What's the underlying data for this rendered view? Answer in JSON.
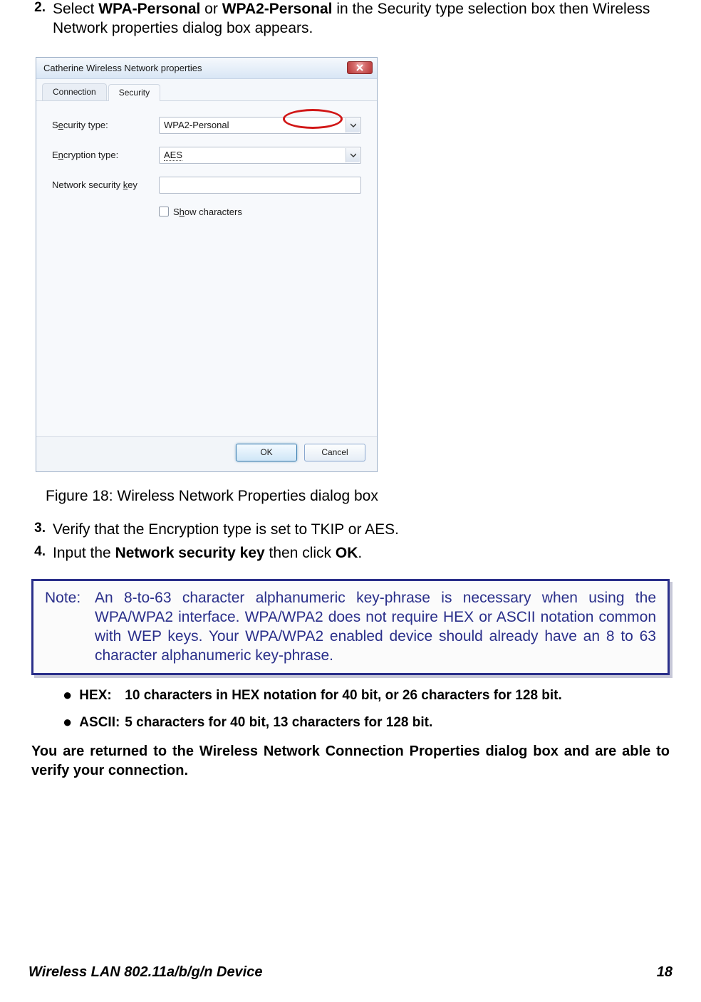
{
  "steps": {
    "s2": {
      "num": "2.",
      "pre": "Select ",
      "b1": "WPA-Personal",
      "mid": " or ",
      "b2": "WPA2-Personal",
      "post": " in the Security type selection box then Wireless Network properties dialog box appears."
    },
    "s3": {
      "num": "3.",
      "text": "Verify that the Encryption type is set to TKIP or AES."
    },
    "s4": {
      "num": "4.",
      "pre": "Input the ",
      "b1": "Network security key",
      "mid": " then click ",
      "b2": "OK",
      "post": "."
    }
  },
  "dialog": {
    "title": "Catherine Wireless Network properties",
    "tabs": {
      "connection": "Connection",
      "security": "Security"
    },
    "labels": {
      "security_type_pre": "S",
      "security_type_u": "e",
      "security_type_post": "curity type:",
      "encryption_pre": "E",
      "encryption_u": "n",
      "encryption_post": "cryption type:",
      "network_key_pre": "Network security ",
      "network_key_u": "k",
      "network_key_post": "ey",
      "show_pre": "S",
      "show_u": "h",
      "show_post": "ow characters"
    },
    "values": {
      "security_type": "WPA2-Personal",
      "encryption_type": "AES",
      "network_key": ""
    },
    "buttons": {
      "ok": "OK",
      "cancel": "Cancel"
    }
  },
  "caption": "Figure 18: Wireless Network Properties dialog box",
  "note": {
    "label": "Note:",
    "text": "An 8-to-63 character alphanumeric key-phrase is necessary when using the WPA/WPA2 interface. WPA/WPA2 does not require HEX or ASCII notation common with WEP keys. Your WPA/WPA2 enabled device should already have an 8 to 63 character alphanumeric key-phrase."
  },
  "bullets": {
    "hex": {
      "key": "HEX:",
      "text": "10 characters in HEX notation for 40 bit, or 26 characters for 128 bit."
    },
    "ascii": {
      "key": "ASCII:",
      "text": "5 characters for 40 bit, 13 characters for 128 bit."
    }
  },
  "conclusion": "You are returned to the Wireless Network Connection Properties dialog box and are able to verify your connection.",
  "footer": {
    "left": "Wireless LAN 802.11a/b/g/n Device",
    "right": "18"
  }
}
